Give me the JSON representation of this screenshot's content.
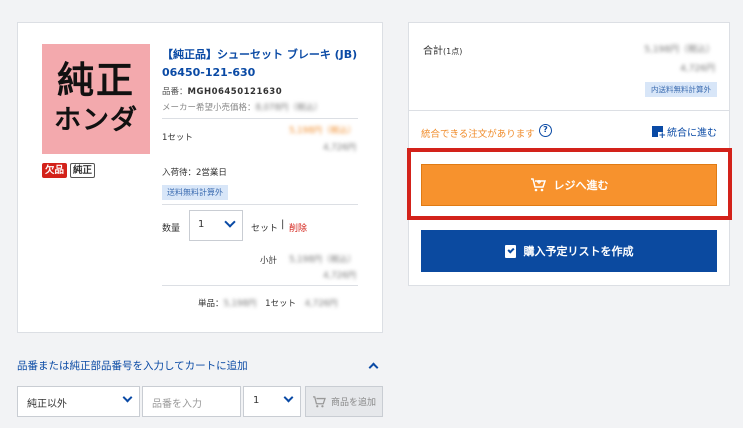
{
  "product": {
    "thumb_line1": "純正",
    "thumb_line2": "ホンダ",
    "tag_out_of_stock": "欠品",
    "tag_genuine": "純正",
    "title": "【純正品】シューセット ブレーキ (JB)",
    "part_number_display": "06450-121-630",
    "sku_label": "品番：",
    "sku": "MGH06450121630",
    "msrp_label": "メーカー希望小売価格：",
    "msrp_value": "8,078円（税込）",
    "unit_qty": "1セット",
    "price_incl": "5,198円（税込）",
    "price_excl": "4,726円",
    "arrival": "入荷待：2営業日",
    "shipping_note": "送料無料計算外",
    "qty_label": "数量",
    "qty_value": "1",
    "set_label": "セット",
    "delete_label": "削除",
    "subtotal_label": "小計",
    "subtotal_incl": "5,198円（税込）",
    "subtotal_excl": "4,726円",
    "unit_label": "単品：",
    "unit_price": "5,198円",
    "unit_set": "1セット",
    "unit_price2": "4,726円"
  },
  "summary": {
    "total_label": "合計",
    "total_count": "(1点)",
    "total_incl": "5,198円（税込）",
    "total_excl": "4,726円",
    "tax_note": "内送料無料計算外",
    "merge_note": "統合できる注文があります",
    "merge_link": "統合に進む",
    "checkout_button": "レジへ進む",
    "wishlist_button": "購入予定リストを作成"
  },
  "add_by_part": {
    "heading": "品番または純正部品番号を入力してカートに追加",
    "type_select": "純正以外",
    "part_placeholder": "品番を入力",
    "qty_value": "1",
    "add_button": "商品を追加"
  },
  "colors": {
    "brand_blue": "#0b4aa0",
    "checkout_orange": "#f7922d",
    "alert_red": "#d3221a"
  }
}
